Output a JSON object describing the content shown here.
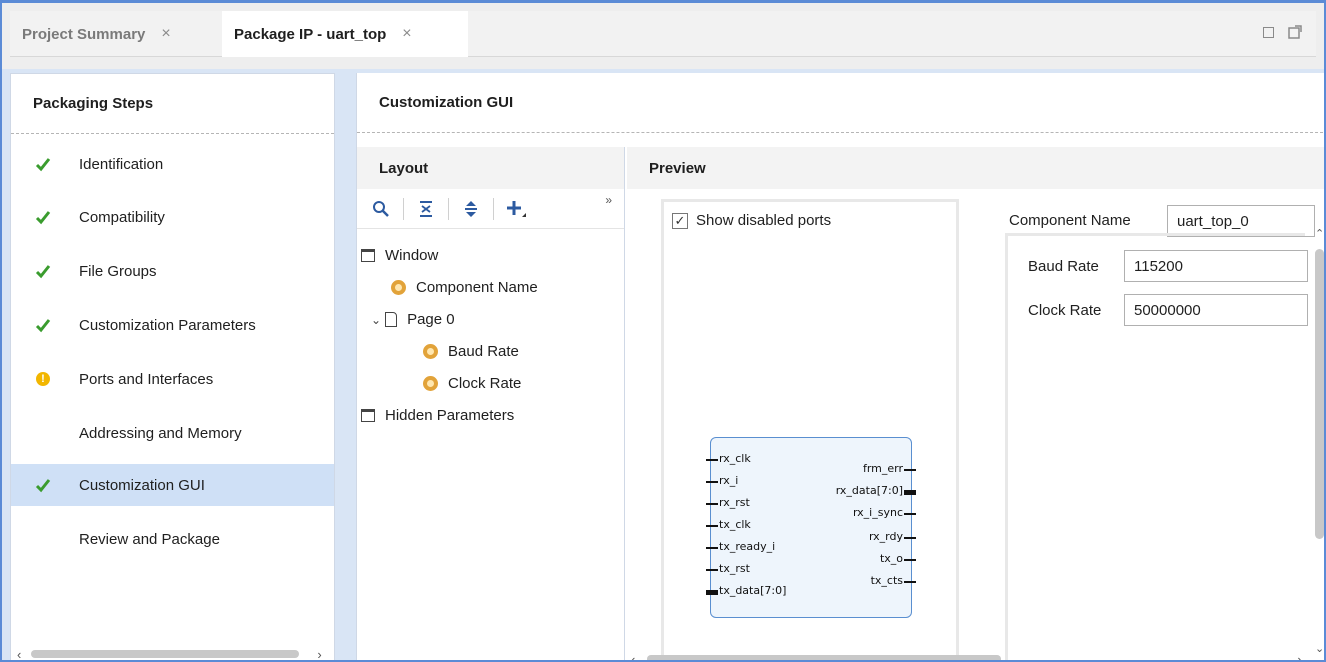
{
  "tabs": [
    {
      "label": "Project Summary",
      "active": false
    },
    {
      "label": "Package IP - uart_top",
      "active": true
    }
  ],
  "tab_close_glyph": "×",
  "window_controls": [
    "maximize-icon",
    "restore-icon"
  ],
  "left_panel": {
    "title": "Packaging Steps",
    "steps": [
      {
        "label": "Identification",
        "status": "check"
      },
      {
        "label": "Compatibility",
        "status": "check"
      },
      {
        "label": "File Groups",
        "status": "check"
      },
      {
        "label": "Customization Parameters",
        "status": "check"
      },
      {
        "label": "Ports and Interfaces",
        "status": "warning"
      },
      {
        "label": "Addressing and Memory",
        "status": "none"
      },
      {
        "label": "Customization GUI",
        "status": "check",
        "selected": true
      },
      {
        "label": "Review and Package",
        "status": "none"
      }
    ]
  },
  "main": {
    "title": "Customization GUI",
    "layout": {
      "title": "Layout",
      "toolbar": [
        "search-icon",
        "collapse-all-icon",
        "expand-all-icon",
        "add-icon"
      ],
      "more_glyph": "»",
      "tree": [
        {
          "label": "Window",
          "icon": "window-icon",
          "level": 0
        },
        {
          "label": "Component Name",
          "icon": "gear-icon",
          "level": 1
        },
        {
          "label": "Page 0",
          "icon": "page-icon",
          "level": 0,
          "expanded": true
        },
        {
          "label": "Baud Rate",
          "icon": "gear-icon",
          "level": 2
        },
        {
          "label": "Clock Rate",
          "icon": "gear-icon",
          "level": 2
        },
        {
          "label": "Hidden Parameters",
          "icon": "window-icon",
          "level": 0
        }
      ]
    },
    "preview": {
      "title": "Preview",
      "show_disabled_ports": {
        "label": "Show disabled ports",
        "checked": true
      },
      "ip_block": {
        "inputs": [
          "rx_clk",
          "rx_i",
          "rx_rst",
          "tx_clk",
          "tx_ready_i",
          "tx_rst",
          "tx_data[7:0]"
        ],
        "outputs": [
          "frm_err",
          "rx_data[7:0]",
          "rx_i_sync",
          "rx_rdy",
          "tx_o",
          "tx_cts"
        ]
      },
      "component_name": {
        "label": "Component Name",
        "value": "uart_top_0"
      },
      "params": [
        {
          "label": "Baud Rate",
          "value": "115200"
        },
        {
          "label": "Clock Rate",
          "value": "50000000"
        }
      ]
    }
  },
  "colors": {
    "accent": "#5b8bd6",
    "selected_row": "#cfe0f6",
    "check_green": "#3a9c2e",
    "warning_yellow": "#f2b600"
  }
}
